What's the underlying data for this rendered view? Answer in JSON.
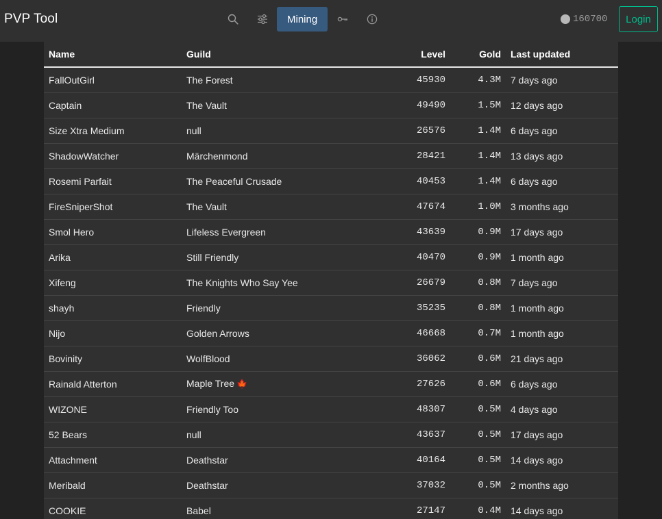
{
  "app": {
    "title": "PVP Tool",
    "mode_button": "Mining",
    "coins": "160700",
    "login": "Login"
  },
  "nav": {
    "icons": [
      "search-icon",
      "sliders-icon",
      "key-icon",
      "info-icon"
    ]
  },
  "colors": {
    "background": "#222222",
    "panel": "#303030",
    "active_button": "#375a7f",
    "login_accent": "#00bc8c"
  },
  "table": {
    "headers": {
      "name": "Name",
      "guild": "Guild",
      "level": "Level",
      "gold": "Gold",
      "updated": "Last updated"
    },
    "rows": [
      {
        "name": "FallOutGirl",
        "guild": "The Forest",
        "level": "45930",
        "gold": "4.3M",
        "updated": "7 days ago"
      },
      {
        "name": "Captain",
        "guild": "The Vault",
        "level": "49490",
        "gold": "1.5M",
        "updated": "12 days ago"
      },
      {
        "name": "Size Xtra Medium",
        "guild": "null",
        "level": "26576",
        "gold": "1.4M",
        "updated": "6 days ago"
      },
      {
        "name": "ShadowWatcher",
        "guild": "Märchenmond",
        "level": "28421",
        "gold": "1.4M",
        "updated": "13 days ago"
      },
      {
        "name": "Rosemi Parfait",
        "guild": "The Peaceful Crusade",
        "level": "40453",
        "gold": "1.4M",
        "updated": "6 days ago"
      },
      {
        "name": "FireSniperShot",
        "guild": "The Vault",
        "level": "47674",
        "gold": "1.0M",
        "updated": "3 months ago"
      },
      {
        "name": "Smol Hero",
        "guild": "Lifeless Evergreen",
        "level": "43639",
        "gold": "0.9M",
        "updated": "17 days ago"
      },
      {
        "name": "Arika",
        "guild": "Still Friendly",
        "level": "40470",
        "gold": "0.9M",
        "updated": "1 month ago"
      },
      {
        "name": "Xifeng",
        "guild": "The Knights Who Say Yee",
        "level": "26679",
        "gold": "0.8M",
        "updated": "7 days ago"
      },
      {
        "name": "shayh",
        "guild": "Friendly",
        "level": "35235",
        "gold": "0.8M",
        "updated": "1 month ago"
      },
      {
        "name": "Nijo",
        "guild": "Golden Arrows",
        "level": "46668",
        "gold": "0.7M",
        "updated": "1 month ago"
      },
      {
        "name": "Bovinity",
        "guild": "WolfBlood",
        "level": "36062",
        "gold": "0.6M",
        "updated": "21 days ago"
      },
      {
        "name": "Rainald Atterton",
        "guild": "Maple Tree",
        "guild_flag": "🍁",
        "level": "27626",
        "gold": "0.6M",
        "updated": "6 days ago"
      },
      {
        "name": "WIZONE",
        "guild": "Friendly Too",
        "level": "48307",
        "gold": "0.5M",
        "updated": "4 days ago"
      },
      {
        "name": "52 Bears",
        "guild": "null",
        "level": "43637",
        "gold": "0.5M",
        "updated": "17 days ago"
      },
      {
        "name": "Attachment",
        "guild": "Deathstar",
        "level": "40164",
        "gold": "0.5M",
        "updated": "14 days ago"
      },
      {
        "name": "Meribald",
        "guild": "Deathstar",
        "level": "37032",
        "gold": "0.5M",
        "updated": "2 months ago"
      },
      {
        "name": "COOKIE",
        "guild": "Babel",
        "level": "27147",
        "gold": "0.4M",
        "updated": "14 days ago"
      }
    ]
  }
}
